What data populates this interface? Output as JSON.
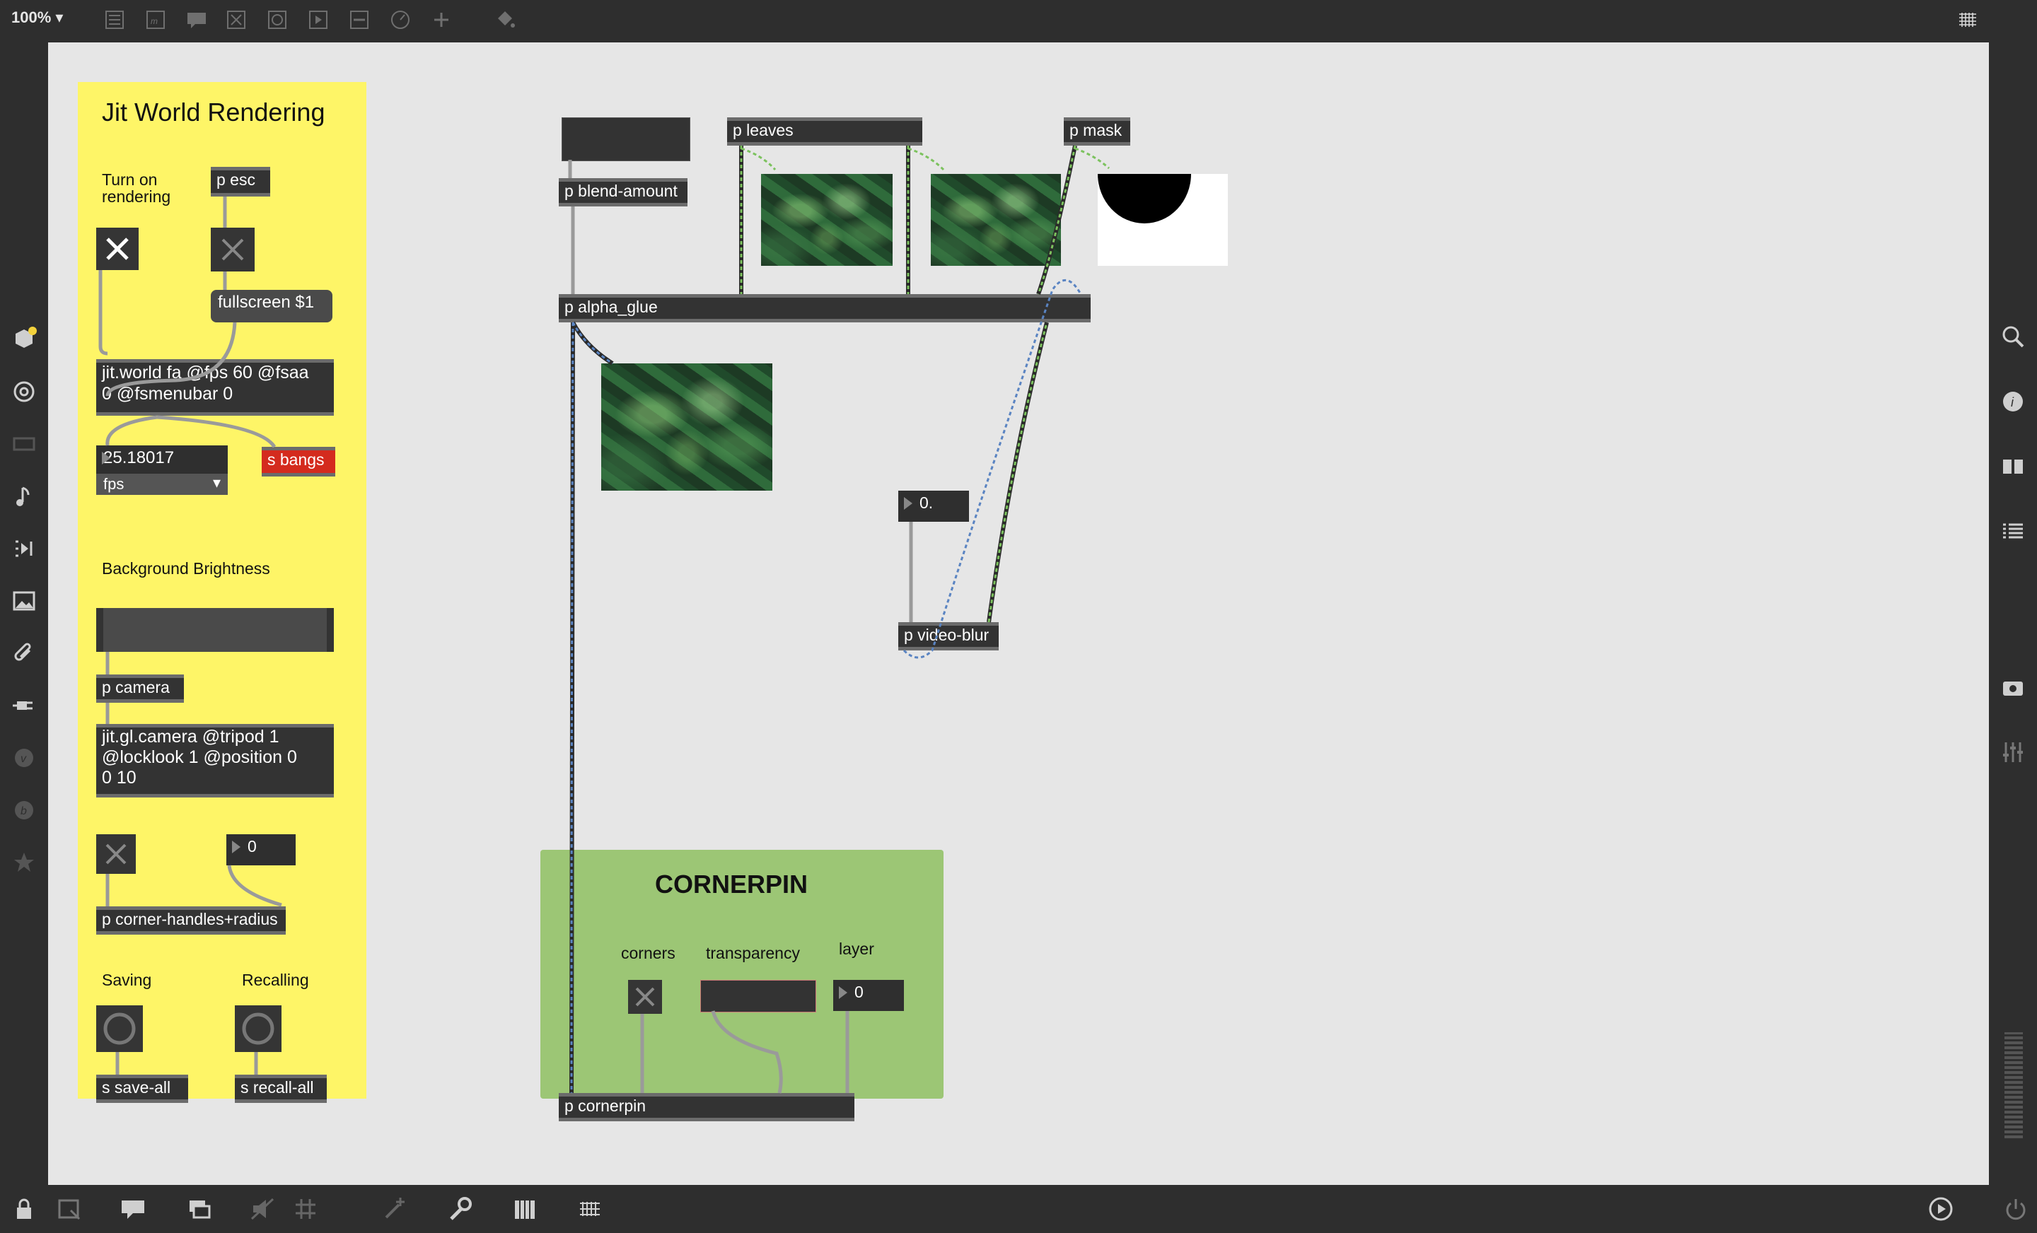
{
  "toolbar": {
    "zoom": "100%",
    "icons": [
      "presentation-icon",
      "text-icon",
      "comment-icon",
      "toggle-icon",
      "button-icon",
      "message-icon",
      "slider-icon",
      "dial-icon",
      "add-icon",
      "paint-bucket-icon",
      "grid-keyboard-icon"
    ]
  },
  "left_sidebar": [
    "object-cube-icon",
    "target-icon",
    "display-icon",
    "music-note-icon",
    "playlist-icon",
    "image-icon",
    "paperclip-icon",
    "plugin-icon",
    "vizzie-icon",
    "bpatcher-icon",
    "favorites-star-icon"
  ],
  "right_sidebar": [
    "search-icon",
    "info-icon",
    "reference-icon",
    "list-icon",
    "snapshot-icon",
    "mixer-icon"
  ],
  "bottombar": [
    "lock-icon",
    "presentation-toggle-icon",
    "comment-bubble-icon",
    "windows-icon",
    "mute-icon",
    "grid-icon",
    "add-object-icon",
    "wrench-icon",
    "piano-icon",
    "keyboard-icon",
    "play-circle-icon",
    "power-icon"
  ],
  "yellow_panel": {
    "title": "Jit World Rendering",
    "turn_on_label": "Turn on\nrendering",
    "esc": "p esc",
    "fullscreen": "fullscreen $1",
    "jitworld": "jit.world fa @fps 60 @fsaa\n0 @fsmenubar 0",
    "fps_value": "25.18017",
    "fps_unit": "fps",
    "s_bangs": "s bangs",
    "bg_brightness": "Background Brightness",
    "camera": "p camera",
    "glcamera": "jit.gl.camera @tripod 1\n@locklook 1 @position 0\n0 10",
    "radius_value": "0",
    "corner_handles": "p corner-handles+radius",
    "saving": "Saving",
    "recalling": "Recalling",
    "save_all": "s save-all",
    "recall_all": "s recall-all"
  },
  "main": {
    "blend_amount": "p blend-amount",
    "leaves": "p leaves",
    "mask": "p mask",
    "alpha_glue": "p alpha_glue",
    "blur_value": "0.",
    "video_blur": "p video-blur"
  },
  "cornerpin_panel": {
    "title": "CORNERPIN",
    "corners": "corners",
    "transparency": "transparency",
    "layer": "layer",
    "layer_value": "0",
    "cornerpin": "p cornerpin"
  },
  "colors": {
    "canvas": "#e6e6e6",
    "yellow_panel": "#fef567",
    "green_panel": "#9cc675",
    "red_send": "#d42b1e",
    "object": "#333333",
    "chrome": "#2e2e2e"
  }
}
